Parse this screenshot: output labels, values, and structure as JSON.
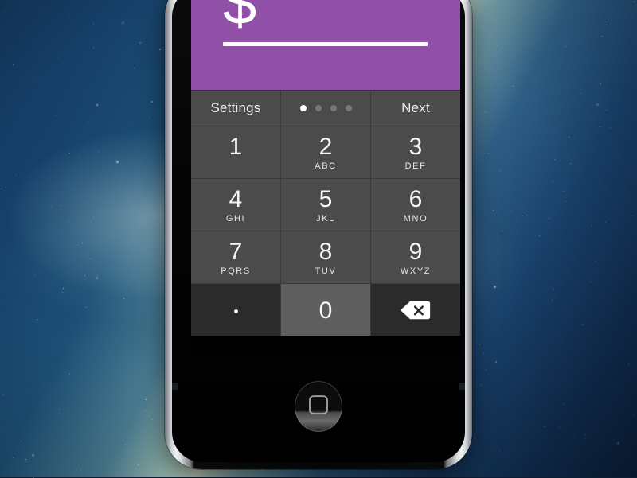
{
  "desktop": {
    "wallpaper_name": "galaxy-wallpaper",
    "colors": {
      "deep_blue": "#13375c",
      "band_light": "#c9d9c0",
      "dark_edge": "#0a1e39"
    }
  },
  "device": {
    "name": "smartphone-mockup",
    "frame_color": "#f2f3f3",
    "bezel_color": "#050505",
    "home_button_label": "Home"
  },
  "app": {
    "amount_panel": {
      "currency_symbol": "$",
      "amount_value": "",
      "amount_placeholder": "",
      "background_color": "#9150a8",
      "underline_color": "#ffffff"
    },
    "toolbar": {
      "settings_label": "Settings",
      "next_label": "Next",
      "page_dots": [
        {
          "active": true
        },
        {
          "active": false
        },
        {
          "active": false
        },
        {
          "active": false
        }
      ],
      "background_color": "#4b4b4b"
    },
    "keypad": {
      "rows": [
        [
          {
            "digit": "1",
            "letters": ""
          },
          {
            "digit": "2",
            "letters": "ABC"
          },
          {
            "digit": "3",
            "letters": "DEF"
          }
        ],
        [
          {
            "digit": "4",
            "letters": "GHI"
          },
          {
            "digit": "5",
            "letters": "JKL"
          },
          {
            "digit": "6",
            "letters": "MNO"
          }
        ],
        [
          {
            "digit": "7",
            "letters": "PQRS"
          },
          {
            "digit": "8",
            "letters": "TUV"
          },
          {
            "digit": "9",
            "letters": "WXYZ"
          }
        ]
      ],
      "bottom_row": {
        "decimal_key": ".",
        "zero_key": "0",
        "backspace_icon": "backspace-delete-icon"
      },
      "key_color": "#4b4b4b",
      "key_dark_color": "#2b2b2b",
      "key_active_color": "#5e5e5e"
    }
  }
}
